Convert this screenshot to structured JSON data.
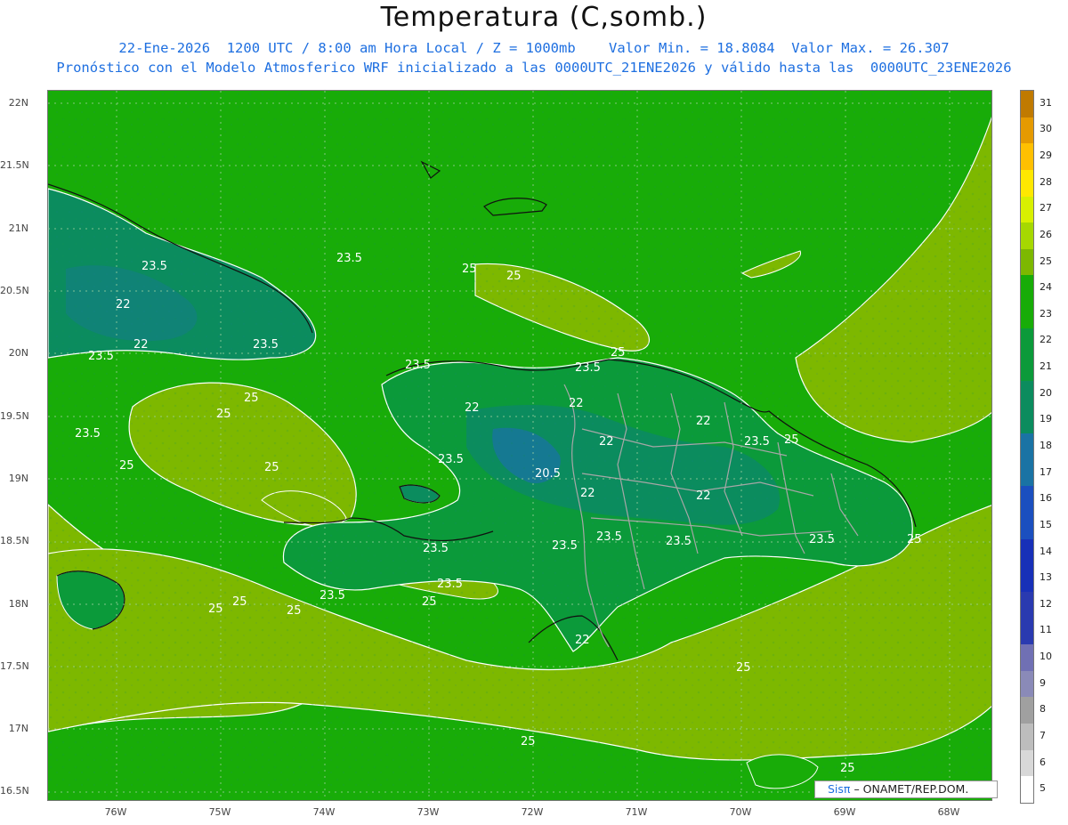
{
  "header": {
    "title": "Temperatura (C,somb.)",
    "subtitle_line1": "22-Ene-2026  1200 UTC / 8:00 am Hora Local / Z = 1000mb    Valor Min. = 18.8084  Valor Max. = 26.307",
    "subtitle_line2": "Pronóstico con el Modelo Atmosferico WRF inicializado a las 0000UTC_21ENE2026 y válido hasta las  0000UTC_23ENE2026"
  },
  "axes": {
    "lat_labels": [
      "22N",
      "21.5N",
      "21N",
      "20.5N",
      "20N",
      "19.5N",
      "19N",
      "18.5N",
      "18N",
      "17.5N",
      "17N",
      "16.5N"
    ],
    "lon_labels": [
      "76W",
      "75W",
      "74W",
      "73W",
      "72W",
      "71W",
      "70W",
      "69W",
      "68W"
    ]
  },
  "legend": {
    "values": [
      "31",
      "30",
      "29",
      "28",
      "27",
      "26",
      "25",
      "24",
      "23",
      "22",
      "21",
      "20",
      "19",
      "18",
      "17",
      "16",
      "15",
      "14",
      "13",
      "12",
      "11",
      "10",
      "9",
      "8",
      "7",
      "6",
      "5"
    ],
    "colors": [
      "#c07a00",
      "#e59a00",
      "#ffc000",
      "#ffe800",
      "#d8f000",
      "#a6d800",
      "#7db800",
      "#18ac08",
      "#18ac08",
      "#0b9a3a",
      "#0b9a3a",
      "#0b8c5e",
      "#0b8c5e",
      "#1a73a4",
      "#1a73a4",
      "#1b4fbf",
      "#1b4fbf",
      "#1830b8",
      "#1830b8",
      "#2a3ab0",
      "#2a3ab0",
      "#7070b4",
      "#8a8ab8",
      "#a0a0a0",
      "#bdbdbd",
      "#d8d8d8",
      "#ffffff"
    ]
  },
  "map": {
    "ocean_color": "#18ac08",
    "warm_color": "#7db800",
    "land_color": "#0b9a3a",
    "cool_color": "#0b8c5e",
    "coldest_color": "#1a73a4",
    "contour_labels": [
      "25",
      "25",
      "25",
      "25",
      "25",
      "25",
      "25",
      "25",
      "25",
      "25",
      "25",
      "25",
      "25",
      "25",
      "25",
      "25",
      "23.5",
      "23.5",
      "23.5",
      "23.5",
      "23.5",
      "23.5",
      "23.5",
      "23.5",
      "23.5",
      "23.5",
      "23.5",
      "23.5",
      "23.5",
      "23.5",
      "23.5",
      "23.5",
      "22",
      "22",
      "22",
      "22",
      "22",
      "22",
      "22",
      "22",
      "22",
      "20.5"
    ]
  },
  "credit": {
    "brand_prefix": "Sis",
    "brand_pi": "π",
    "brand_suffix": "– ONAMET/REP.DOM."
  }
}
